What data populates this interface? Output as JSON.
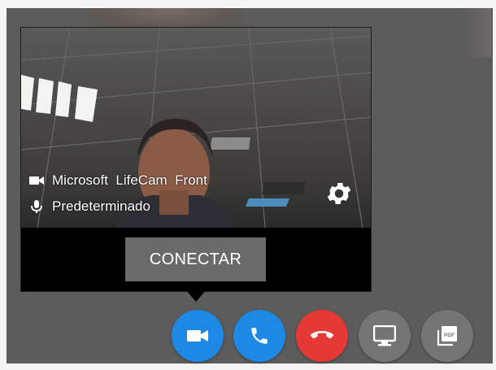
{
  "preview": {
    "camera_name": "Microsoft  LifeCam  Front",
    "microphone_name": "Predeterminado",
    "connect_label": "CONECTAR"
  },
  "icons": {
    "camera": "videocam-icon",
    "microphone": "mic-icon",
    "settings": "gear-icon",
    "video_call": "videocam-icon",
    "audio_call": "phone-icon",
    "hang_up": "call-end-icon",
    "screen_share": "monitor-icon",
    "pdf_share": "pdf-stack-icon"
  },
  "colors": {
    "video_button": "#1e88e5",
    "audio_button": "#1e88e5",
    "hangup_button": "#e53935",
    "screen_button": "#757575",
    "pdf_button": "#757575",
    "connect_button": "#6a6a6a",
    "overlay": "#5c5c5c"
  }
}
